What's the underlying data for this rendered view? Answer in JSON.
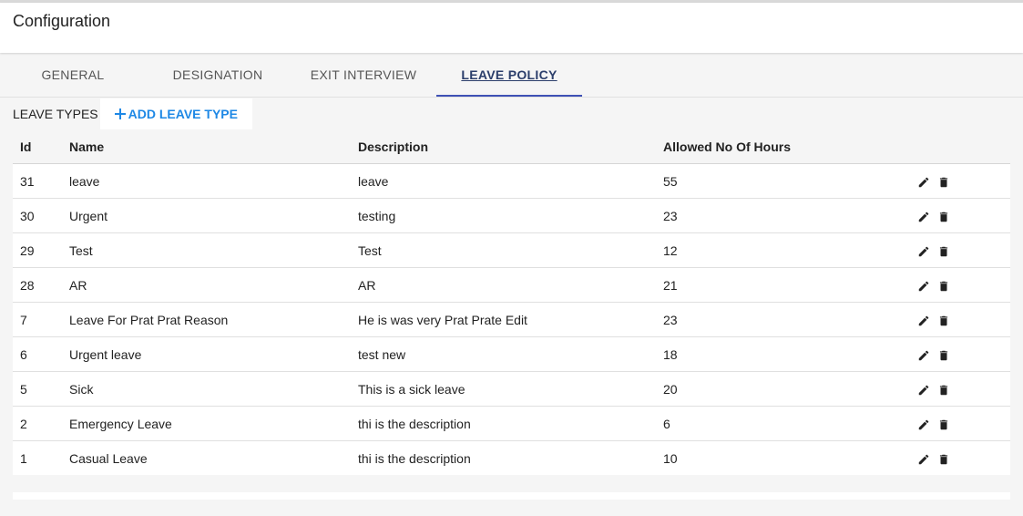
{
  "header": {
    "title": "Configuration"
  },
  "tabs": [
    {
      "label": "GENERAL"
    },
    {
      "label": "DESIGNATION"
    },
    {
      "label": "EXIT INTERVIEW"
    },
    {
      "label": "LEAVE POLICY",
      "active": true
    }
  ],
  "toolbar": {
    "label": "LEAVE TYPES",
    "add_label": "ADD LEAVE TYPE"
  },
  "table": {
    "headers": {
      "id": "Id",
      "name": "Name",
      "description": "Description",
      "hours": "Allowed No Of Hours"
    },
    "rows": [
      {
        "id": "31",
        "name": "leave",
        "description": "leave",
        "hours": "55"
      },
      {
        "id": "30",
        "name": "Urgent",
        "description": "testing",
        "hours": "23"
      },
      {
        "id": "29",
        "name": "Test",
        "description": "Test",
        "hours": "12"
      },
      {
        "id": "28",
        "name": "AR",
        "description": "AR",
        "hours": "21"
      },
      {
        "id": "7",
        "name": "Leave For Prat Prat Reason",
        "description": "He is was very Prat Prate Edit",
        "hours": "23"
      },
      {
        "id": "6",
        "name": "Urgent leave",
        "description": "test new",
        "hours": "18"
      },
      {
        "id": "5",
        "name": "Sick",
        "description": "This is a sick leave",
        "hours": "20"
      },
      {
        "id": "2",
        "name": "Emergency Leave",
        "description": "thi is the description",
        "hours": "6"
      },
      {
        "id": "1",
        "name": "Casual Leave",
        "description": "thi is the description",
        "hours": "10"
      }
    ]
  },
  "icons": {
    "edit": "pencil-icon",
    "delete": "trash-icon"
  },
  "colors": {
    "accent": "#1e88e5",
    "tab_indicator": "#3f51b5",
    "active_tab_text": "#2b3e6b"
  }
}
